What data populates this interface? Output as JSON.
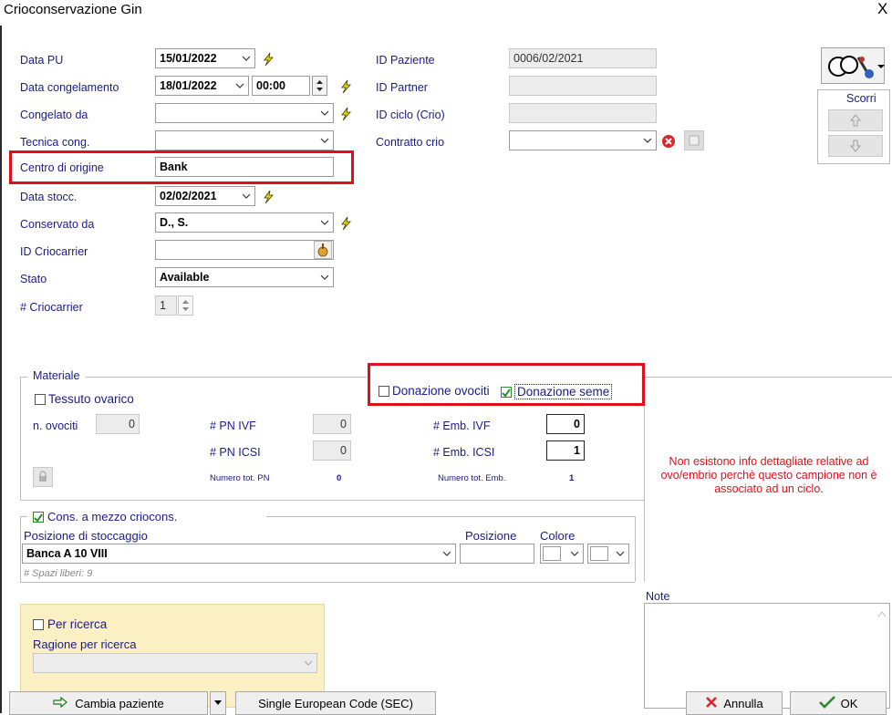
{
  "window": {
    "title": "Crioconservazione Gin",
    "close_glyph": "X"
  },
  "form": {
    "data_pu": {
      "label": "Data PU",
      "value": "15/01/2022"
    },
    "data_congelamento": {
      "label": "Data congelamento",
      "value": "18/01/2022",
      "time": "00:00"
    },
    "congelato_da": {
      "label": "Congelato da",
      "value": ""
    },
    "tecnica_cong": {
      "label": "Tecnica cong.",
      "value": ""
    },
    "centro_origine": {
      "label": "Centro di origine",
      "value": "Bank"
    },
    "data_stocc": {
      "label": "Data stocc.",
      "value": "02/02/2021"
    },
    "conservato_da": {
      "label": "Conservato da",
      "value": "D., S."
    },
    "id_criocarrier": {
      "label": "ID Criocarrier",
      "value": ""
    },
    "stato": {
      "label": "Stato",
      "value": "Available"
    },
    "n_criocarrier": {
      "label": "# Criocarrier",
      "value": "1"
    }
  },
  "right_form": {
    "id_paziente": {
      "label": "ID Paziente",
      "value": "0006/02/2021"
    },
    "id_partner": {
      "label": "ID Partner",
      "value": ""
    },
    "id_ciclo": {
      "label": "ID ciclo (Crio)",
      "value": ""
    },
    "contratto_crio": {
      "label": "Contratto crio",
      "value": ""
    }
  },
  "scroll_panel": {
    "label": "Scorri"
  },
  "materiale": {
    "legend": "Materiale",
    "tessuto_ovarico": "Tessuto ovarico",
    "donazione_ovociti": "Donazione ovociti",
    "donazione_seme": "Donazione seme",
    "n_ovociti": {
      "label": "n. ovociti",
      "value": "0"
    },
    "pn_ivf": {
      "label": "# PN IVF",
      "value": "0"
    },
    "pn_icsi": {
      "label": "# PN ICSI",
      "value": "0"
    },
    "emb_ivf": {
      "label": "# Emb. IVF",
      "value": "0"
    },
    "emb_icsi": {
      "label": "# Emb. ICSI",
      "value": "1"
    },
    "tot_pn": {
      "label": "Numero tot. PN",
      "value": "0"
    },
    "tot_emb": {
      "label": "Numero tot. Emb.",
      "value": "1"
    }
  },
  "info_message": "Non esistono info dettagliate relative ad ovo/embrio perchè questo campione non è associato ad un ciclo.",
  "storage": {
    "legend": "Cons. a mezzo criocons.",
    "posizione_stoccaggio_label": "Posizione di stoccaggio",
    "posizione_stoccaggio_value": "Banca A 10 VIII",
    "posizione_label": "Posizione",
    "posizione_value": "",
    "colore_label": "Colore",
    "spazi_liberi": "# Spazi liberi: 9"
  },
  "ricerca": {
    "per_ricerca": "Per ricerca",
    "ragione_label": "Ragione per ricerca",
    "ragione_value": ""
  },
  "note": {
    "label": "Note",
    "value": ""
  },
  "buttons": {
    "cambia_paziente": "Cambia paziente",
    "sec": "Single European Code (SEC)",
    "annulla": "Annulla",
    "ok": "OK"
  },
  "colors": {
    "label_blue": "#1a1a8a",
    "highlight_red": "#e0101a",
    "research_panel": "#fbf0c4",
    "check_green": "#2b8a2b"
  }
}
